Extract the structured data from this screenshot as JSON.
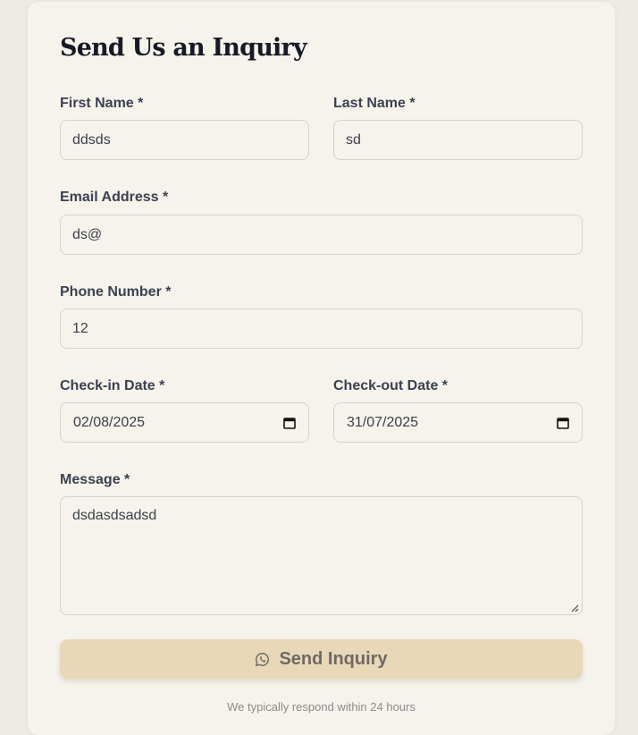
{
  "form": {
    "title": "Send Us an Inquiry",
    "first_name": {
      "label": "First Name *",
      "value": "ddsds"
    },
    "last_name": {
      "label": "Last Name *",
      "value": "sd"
    },
    "email": {
      "label": "Email Address *",
      "value": "ds@"
    },
    "phone": {
      "label": "Phone Number *",
      "value": "12"
    },
    "check_in": {
      "label": "Check-in Date *",
      "value": "02/08/2025"
    },
    "check_out": {
      "label": "Check-out Date *",
      "value": "31/07/2025"
    },
    "message": {
      "label": "Message *",
      "value": "dsdasdsadsd"
    },
    "submit": {
      "label": "Send Inquiry",
      "icon": "whatsapp-icon"
    },
    "footnote": "We typically respond within 24 hours"
  }
}
